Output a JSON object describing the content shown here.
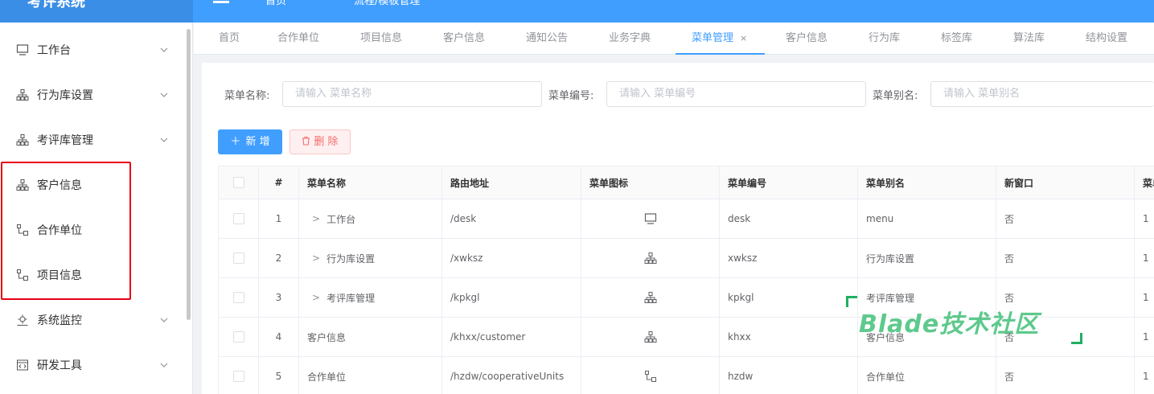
{
  "app": {
    "title": "考评系统",
    "colors": {
      "primary": "#409eff",
      "danger": "#f56c6c",
      "highlight": "#e60012"
    }
  },
  "topbar": {
    "home": "首页",
    "breadcrumb": "流程/模板管理"
  },
  "sidebar": {
    "items": [
      {
        "label": "工作台",
        "icon": "monitor-icon",
        "expandable": true
      },
      {
        "label": "行为库设置",
        "icon": "hierarchy-icon",
        "expandable": true
      },
      {
        "label": "考评库管理",
        "icon": "hierarchy-icon",
        "expandable": true
      },
      {
        "label": "客户信息",
        "icon": "hierarchy-icon",
        "expandable": false
      },
      {
        "label": "合作单位",
        "icon": "tree-icon",
        "expandable": false
      },
      {
        "label": "项目信息",
        "icon": "tree-icon",
        "expandable": false
      },
      {
        "label": "系统监控",
        "icon": "monitor-gear-icon",
        "expandable": true
      },
      {
        "label": "研发工具",
        "icon": "code-icon",
        "expandable": true
      }
    ]
  },
  "tabs": [
    {
      "label": "首页"
    },
    {
      "label": "合作单位"
    },
    {
      "label": "项目信息"
    },
    {
      "label": "客户信息"
    },
    {
      "label": "通知公告"
    },
    {
      "label": "业务字典"
    },
    {
      "label": "菜单管理",
      "active": true,
      "close": "×"
    },
    {
      "label": "客户信息"
    },
    {
      "label": "行为库"
    },
    {
      "label": "标签库"
    },
    {
      "label": "算法库"
    },
    {
      "label": "结构设置"
    }
  ],
  "search": {
    "name_label": "菜单名称:",
    "name_placeholder": "请输入 菜单名称",
    "code_label": "菜单编号:",
    "code_placeholder": "请输入 菜单编号",
    "alias_label": "菜单别名:",
    "alias_placeholder": "请输入 菜单别名"
  },
  "actions": {
    "add": "新 增",
    "delete": "删 除"
  },
  "table": {
    "headers": [
      "#",
      "菜单名称",
      "路由地址",
      "菜单图标",
      "菜单编号",
      "菜单别名",
      "新窗口",
      "菜单"
    ],
    "rows": [
      {
        "index": "1",
        "name": "工作台",
        "path": "/desk",
        "icon": "monitor-icon",
        "code": "desk",
        "alias": "menu",
        "new_window": "否",
        "sort": "1",
        "expandable": true
      },
      {
        "index": "2",
        "name": "行为库设置",
        "path": "/xwksz",
        "icon": "hierarchy-icon",
        "code": "xwksz",
        "alias": "行为库设置",
        "new_window": "否",
        "sort": "1",
        "expandable": true
      },
      {
        "index": "3",
        "name": "考评库管理",
        "path": "/kpkgl",
        "icon": "hierarchy-icon",
        "code": "kpkgl",
        "alias": "考评库管理",
        "new_window": "否",
        "sort": "1",
        "expandable": true
      },
      {
        "index": "4",
        "name": "客户信息",
        "path": "/khxx/customer",
        "icon": "hierarchy-icon",
        "code": "khxx",
        "alias": "客户信息",
        "new_window": "否",
        "sort": "1",
        "expandable": false
      },
      {
        "index": "5",
        "name": "合作单位",
        "path": "/hzdw/cooperativeUnits",
        "icon": "tree-icon",
        "code": "hzdw",
        "alias": "合作单位",
        "new_window": "否",
        "sort": "1",
        "expandable": false
      }
    ]
  },
  "watermark": {
    "text": "Blade技术社区"
  }
}
